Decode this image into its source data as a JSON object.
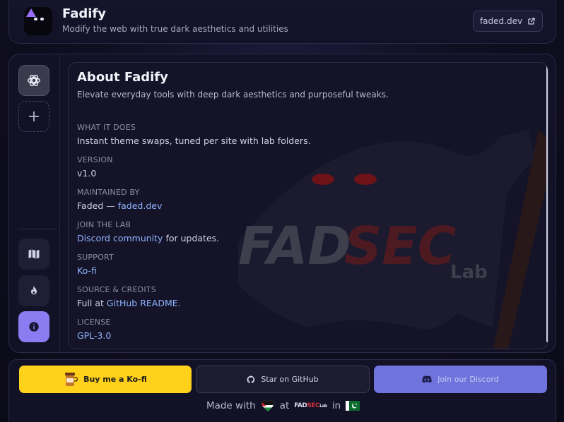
{
  "header": {
    "title": "Fadify",
    "subtitle": "Modify the web with true dark aesthetics and utilities",
    "site_link": "faded.dev"
  },
  "sidebar": {
    "items": [
      {
        "icon": "openai-icon",
        "active": true
      },
      {
        "icon": "plus-icon"
      },
      {
        "icon": "map-icon"
      },
      {
        "icon": "flame-icon"
      },
      {
        "icon": "info-icon",
        "selected": true
      }
    ]
  },
  "about": {
    "title": "About Fadify",
    "subtitle": "Elevate everyday tools with deep dark aesthetics and purposeful tweaks.",
    "what_label": "WHAT IT DOES",
    "what_value": "Instant theme swaps, tuned per site with lab folders.",
    "version_label": "VERSION",
    "version_value": "v1.0",
    "maintained_label": "MAINTAINED BY",
    "maintained_prefix": "Faded —",
    "maintained_link": "faded.dev",
    "lab_label": "JOIN THE LAB",
    "lab_link": "Discord community",
    "lab_suffix": "for updates.",
    "support_label": "SUPPORT",
    "support_link": "Ko-fi",
    "source_label": "SOURCE & CREDITS",
    "source_prefix": "Full at",
    "source_link": "GitHub README.",
    "license_label": "LICENSE",
    "license_link": "GPL-3.0"
  },
  "watermark": {
    "text_left": "FAD",
    "text_right": "SEC",
    "text_small": "Lab"
  },
  "footer": {
    "kofi_label": "Buy me a Ko-fi",
    "github_label": "Star on GitHub",
    "discord_label": "Join our Discord",
    "made_with": "Made with",
    "at": "at",
    "in": "in",
    "mini_logo_left": "FAD",
    "mini_logo_right": "SEC",
    "mini_logo_small": "Lab"
  },
  "colors": {
    "accent": "#8c7cf2",
    "link": "#8fb4ff",
    "kofi": "#ffd11a",
    "discord": "#6f74dd",
    "watermark_red": "#c8202c"
  }
}
